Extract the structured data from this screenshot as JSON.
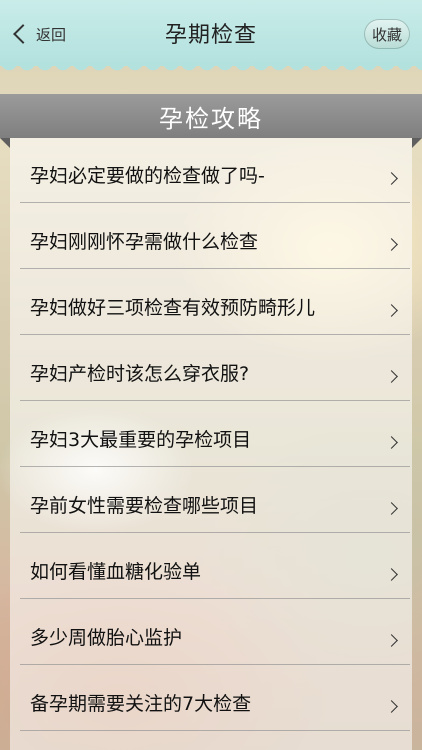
{
  "nav": {
    "back_label": "返回",
    "title": "孕期检查",
    "favorite_label": "收藏"
  },
  "section": {
    "title": "孕检攻略"
  },
  "list": {
    "items": [
      {
        "label": "孕妇必定要做的检查做了吗-"
      },
      {
        "label": "孕妇刚刚怀孕需做什么检查"
      },
      {
        "label": "孕妇做好三项检查有效预防畸形儿"
      },
      {
        "label": "孕妇产检时该怎么穿衣服?"
      },
      {
        "label": "孕妇3大最重要的孕检项目"
      },
      {
        "label": "孕前女性需要检查哪些项目"
      },
      {
        "label": "如何看懂血糖化验单"
      },
      {
        "label": "多少周做胎心监护"
      },
      {
        "label": "备孕期需要关注的7大检查"
      }
    ]
  },
  "colors": {
    "navbar": "#b3e1de",
    "section_header": "#8c8c8c"
  }
}
